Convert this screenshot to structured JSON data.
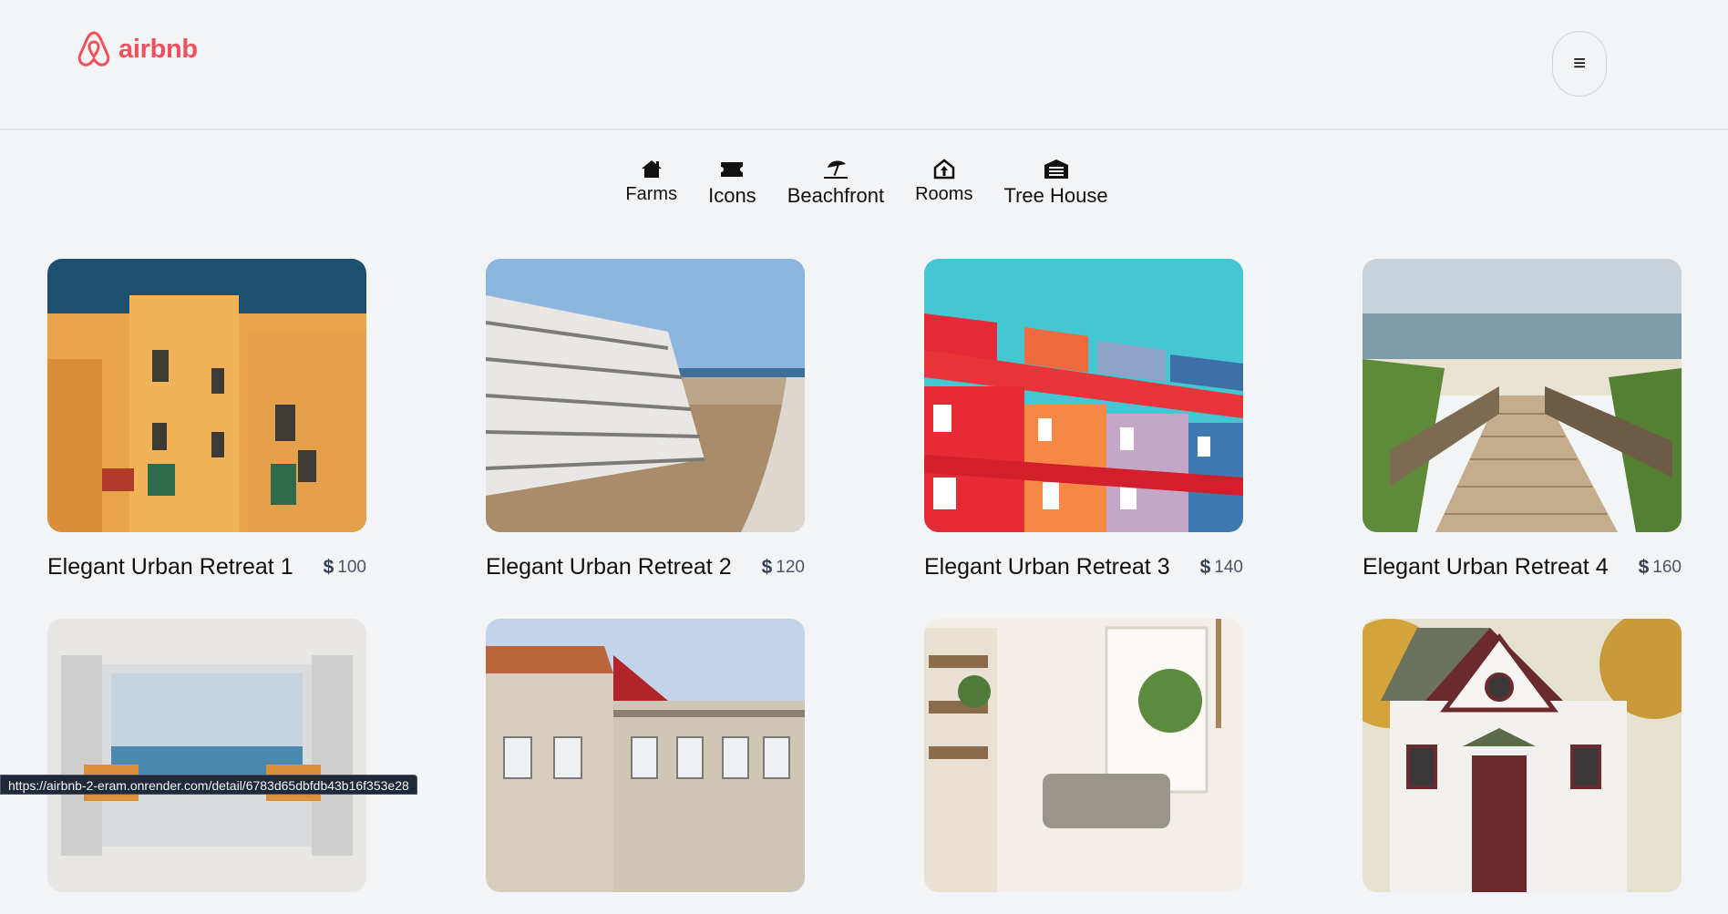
{
  "header": {
    "logo_text": "airbnb",
    "logo_icon": "airbnb-logo-icon",
    "menu_icon": "hamburger-icon",
    "menu_glyph": "≡"
  },
  "categories": [
    {
      "label": "Farms",
      "icon": "farmhouse-icon"
    },
    {
      "label": "Icons",
      "icon": "ticket-icon"
    },
    {
      "label": "Beachfront",
      "icon": "umbrella-beach-icon"
    },
    {
      "label": "Rooms",
      "icon": "house-arrow-icon"
    },
    {
      "label": "Tree House",
      "icon": "garage-icon"
    }
  ],
  "listings": [
    {
      "title": "Elegant Urban Retreat 1",
      "currency": "$",
      "price": "100"
    },
    {
      "title": "Elegant Urban Retreat 2",
      "currency": "$",
      "price": "120"
    },
    {
      "title": "Elegant Urban Retreat 3",
      "currency": "$",
      "price": "140"
    },
    {
      "title": "Elegant Urban Retreat 4",
      "currency": "$",
      "price": "160"
    },
    {
      "title": "",
      "currency": "",
      "price": ""
    },
    {
      "title": "",
      "currency": "",
      "price": ""
    },
    {
      "title": "",
      "currency": "",
      "price": ""
    },
    {
      "title": "",
      "currency": "",
      "price": ""
    }
  ],
  "status_url": "https://airbnb-2-eram.onrender.com/detail/6783d65dbfdb43b16f353e28"
}
